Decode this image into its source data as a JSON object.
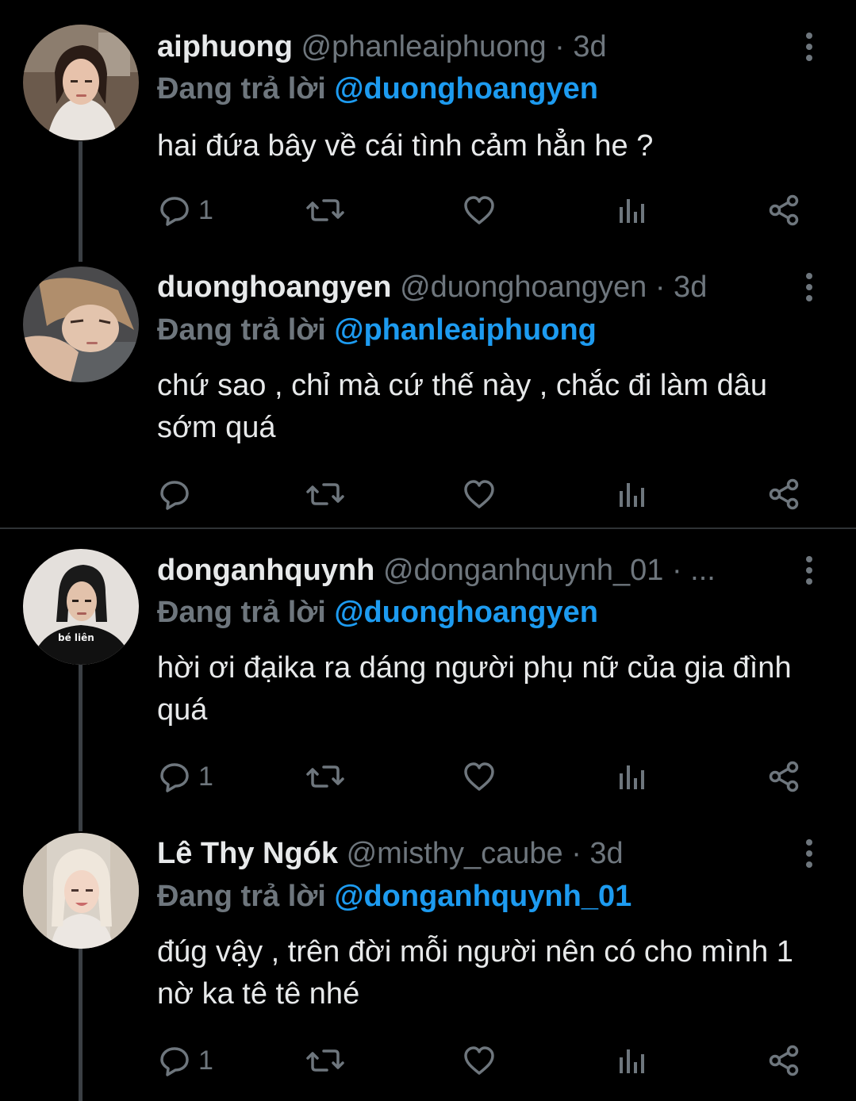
{
  "colors": {
    "background": "#000000",
    "text": "#e7e9ea",
    "muted": "#6e767d",
    "mention": "#1d9bf0",
    "thread_line": "#3b3f44"
  },
  "icons": {
    "reply": "comment-bubble-icon",
    "retweet": "retweet-icon",
    "like": "heart-icon",
    "analytics": "bar-chart-icon",
    "share": "share-icon",
    "more": "vertical-dots-icon"
  },
  "tweets": [
    {
      "name": "aiphuong",
      "handle": "@phanleaiphuong",
      "time": "· 3d",
      "reply_prefix": "Đang trả lời",
      "reply_to": "@duonghoangyen",
      "body": "hai đứa bây về cái tình cảm hẳn he ?",
      "reply_count": "1"
    },
    {
      "name": "duonghoangyen",
      "handle": "@duonghoangyen",
      "time": "· 3d",
      "reply_prefix": "Đang trả lời",
      "reply_to": "@phanleaiphuong",
      "body": "chứ sao , chỉ mà cứ thế này , chắc đi làm dâu sớm quá",
      "reply_count": ""
    },
    {
      "name": "donganhquynh",
      "handle": "@donganhquynh_01",
      "time": "· ...",
      "reply_prefix": "Đang trả lời",
      "reply_to": "@duonghoangyen",
      "body": "hời ơi đạika ra dáng người phụ nữ của gia đình quá",
      "reply_count": "1"
    },
    {
      "name": "Lê Thy Ngók",
      "handle": "@misthy_caube",
      "time": "· 3d",
      "reply_prefix": "Đang trả lời",
      "reply_to": "@donganhquynh_01",
      "body": "đúg vậy , trên đời mỗi người nên có cho mình 1 nờ ka tê tê nhé",
      "reply_count": "1"
    }
  ],
  "avatar_shirt_text": "bé liên"
}
